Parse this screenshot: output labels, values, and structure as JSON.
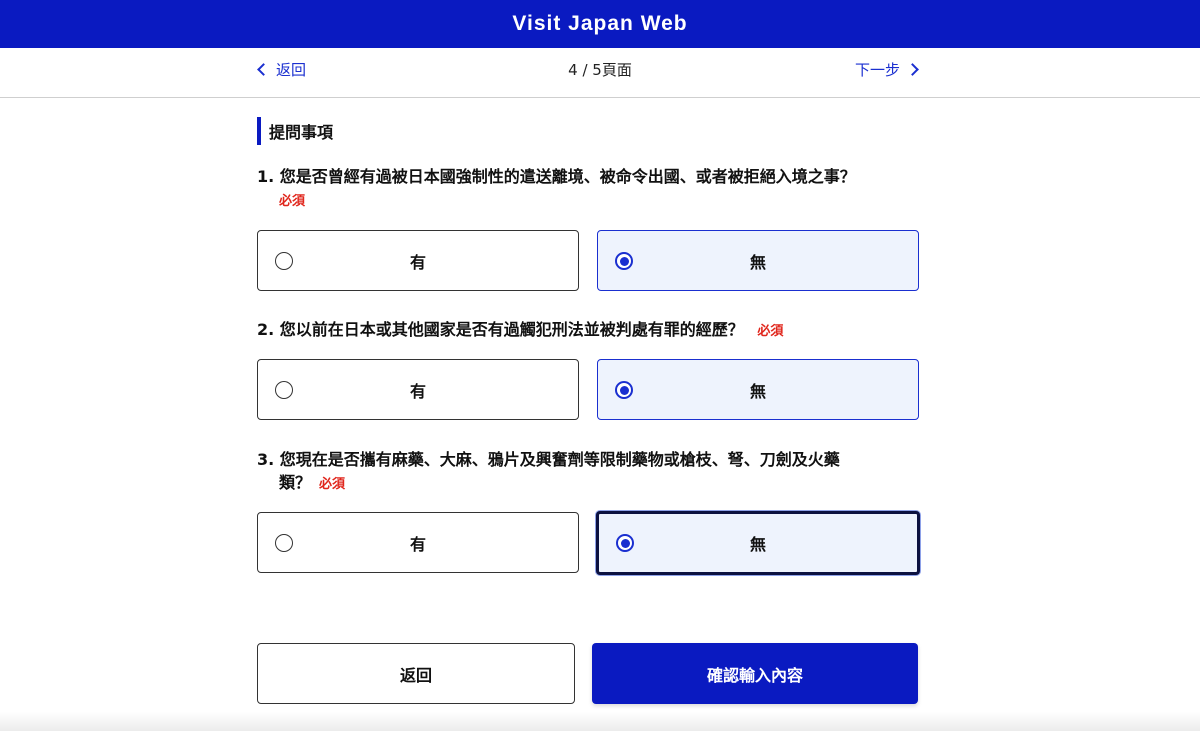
{
  "header": {
    "title": "Visit Japan Web"
  },
  "nav": {
    "back_label": "返回",
    "page_indicator": "4 / 5頁面",
    "next_label": "下一步"
  },
  "section": {
    "title": "提問事項"
  },
  "questions": [
    {
      "number": "1.",
      "text": "您是否曾經有過被日本國強制性的遣送離境、被命令出國、或者被拒絕入境之事？",
      "required": "必須",
      "options": [
        {
          "label": "有",
          "selected": false
        },
        {
          "label": "無",
          "selected": true
        }
      ]
    },
    {
      "number": "2.",
      "text": "您以前在日本或其他國家是否有過觸犯刑法並被判處有罪的經歷？",
      "required": "必須",
      "options": [
        {
          "label": "有",
          "selected": false
        },
        {
          "label": "無",
          "selected": true
        }
      ]
    },
    {
      "number": "3.",
      "text_line1": "您現在是否攜有麻藥、大麻、鴉片及興奮劑等限制藥物或槍枝、弩、刀劍及火藥",
      "text_line2": "類？",
      "required": "必須",
      "options": [
        {
          "label": "有",
          "selected": false
        },
        {
          "label": "無",
          "selected": true
        }
      ]
    }
  ],
  "footer": {
    "back_button": "返回",
    "confirm_button": "確認輸入內容"
  },
  "colors": {
    "brand": "#0a1ac1",
    "link": "#1a2fd0",
    "required": "#e0261c",
    "selected_bg": "#eef3fd"
  }
}
